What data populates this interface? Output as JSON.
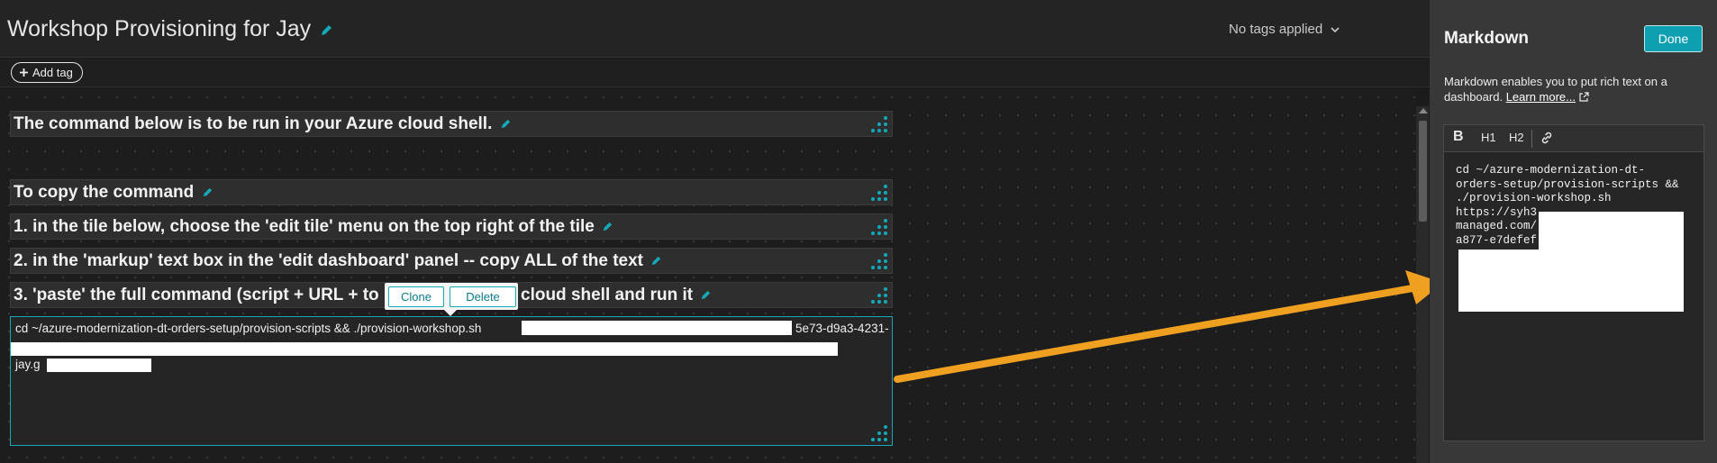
{
  "dashboard": {
    "title": "Workshop Provisioning for Jay",
    "tags_dropdown": "No tags applied",
    "add_tag": "Add tag"
  },
  "tiles": [
    "The command below is to be run in your Azure cloud shell.",
    "To copy the command",
    "1. in the tile below, choose the 'edit tile' menu on the top right of the tile",
    "2. in the 'markup' text box in the 'edit dashboard' panel -- copy ALL of the text",
    "3. 'paste' the full command (script + URL + to",
    "cloud shell and run it"
  ],
  "popover": {
    "clone": "Clone",
    "delete": "Delete"
  },
  "command_tile": {
    "line1": "cd ~/azure-modernization-dt-orders-setup/provision-scripts && ./provision-workshop.sh",
    "line1_suffix": "5e73-d9a3-4231-",
    "line3_prefix": "jay.g"
  },
  "panel": {
    "title": "Markdown",
    "done": "Done",
    "description": "Markdown enables you to put rich text on a dashboard.",
    "learn_more": "Learn more...",
    "toolbar": {
      "bold": "B",
      "h1": "H1",
      "h2": "H2"
    },
    "editor_lines": [
      "cd ~/azure-modernization-dt-",
      "orders-setup/provision-scripts &&",
      "./provision-workshop.sh",
      "https://syh3",
      "managed.com/",
      "a877-e7defef"
    ]
  },
  "colors": {
    "accent": "#14a8b8",
    "arrow": "#f0a020",
    "done_button": "#0e9fb0"
  }
}
